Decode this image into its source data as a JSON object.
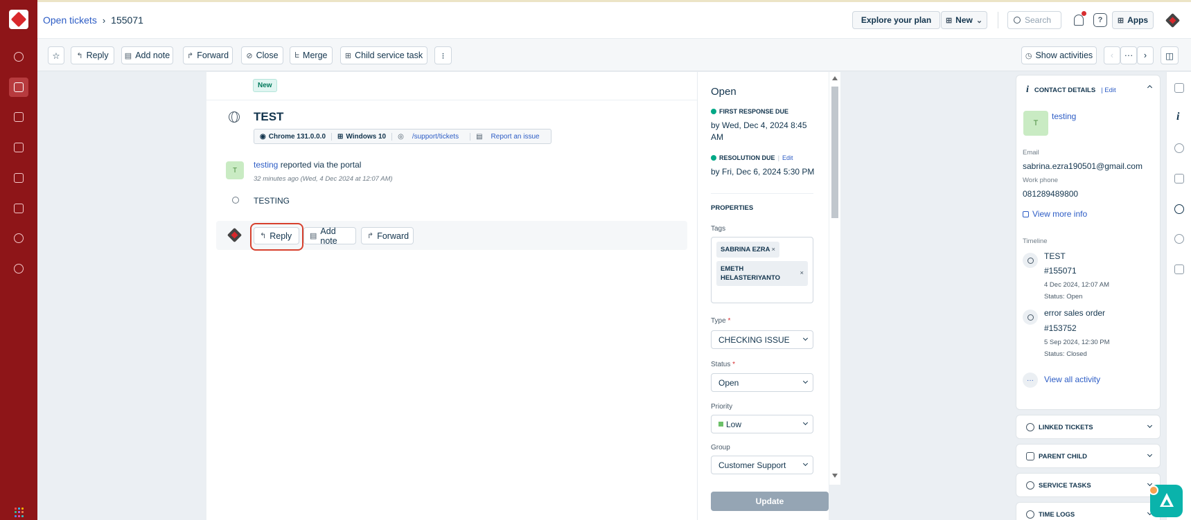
{
  "nav": {
    "items": [
      "dashboard-icon",
      "tickets-icon",
      "contacts-icon",
      "solutions-icon",
      "forums-icon",
      "reports-icon",
      "compass-icon",
      "admin-gear-icon"
    ],
    "apps_colors": [
      "#f24c4c",
      "#2fb6f0",
      "#f7b500",
      "#36c08f",
      "#9d6bf3",
      "#f27d4c",
      "#4c8cf2",
      "#e94cb8",
      "#33c2c2"
    ]
  },
  "breadcrumb": {
    "parent": "Open tickets",
    "separator": "›",
    "current": "155071"
  },
  "header": {
    "explore_plan": "Explore your plan",
    "new_label": "New",
    "search_placeholder": "Search",
    "help_label": "?",
    "apps_label": "Apps"
  },
  "toolbar": {
    "reply": "Reply",
    "add_note": "Add note",
    "forward": "Forward",
    "close": "Close",
    "merge": "Merge",
    "child_service_task": "Child service task",
    "more": "⁝",
    "show_activities": "Show activities",
    "prev": "‹",
    "dots": "···",
    "next": "›"
  },
  "ticket": {
    "badge": "New",
    "title": "TEST",
    "browser": "Chrome 131.0.0.0",
    "os": "Windows 10",
    "path": "/support/tickets",
    "report": "Report an issue",
    "requester_initial": "T",
    "requester_name": "testing",
    "reported_via": "reported via the portal",
    "time_ago": "32 minutes ago (Wed, 4 Dec 2024 at 12:07 AM)",
    "description": "TESTING"
  },
  "reply_bar": {
    "reply": "Reply",
    "add_note": "Add note",
    "forward": "Forward"
  },
  "properties": {
    "status_heading": "Open",
    "first_response_label": "FIRST RESPONSE DUE",
    "first_response_value": "by Wed, Dec 4, 2024 8:45 AM",
    "resolution_label": "RESOLUTION DUE",
    "resolution_edit": "Edit",
    "resolution_value": "by Fri, Dec 6, 2024 5:30 PM",
    "properties_heading": "PROPERTIES",
    "tags_label": "Tags",
    "tags": [
      "SABRINA EZRA",
      "EMETH HELASTERIYANTO"
    ],
    "tag_remove": "×",
    "type_label": "Type",
    "type_value": "CHECKING ISSUE",
    "status_label": "Status",
    "status_value": "Open",
    "priority_label": "Priority",
    "priority_value": "Low",
    "priority_color": "#6cc069",
    "group_label": "Group",
    "group_value": "Customer Support",
    "required_mark": "*",
    "update_button": "Update"
  },
  "contact": {
    "heading": "CONTACT DETAILS",
    "edit": "| Edit",
    "initial": "T",
    "name": "testing",
    "email_label": "Email",
    "email": "sabrina.ezra190501@gmail.com",
    "phone_label": "Work phone",
    "phone": "081289489800",
    "view_more": "View more info",
    "timeline_label": "Timeline",
    "timeline": [
      {
        "title": "TEST",
        "id": "#155071",
        "date": "4 Dec 2024, 12:07 AM",
        "status": "Status: Open"
      },
      {
        "title": "error sales order",
        "id": "#153752",
        "date": "5 Sep 2024, 12:30 PM",
        "status": "Status: Closed"
      }
    ],
    "view_all": "View all activity"
  },
  "accordions": {
    "linked": "LINKED TICKETS",
    "parent_child": "PARENT CHILD",
    "service_tasks": "SERVICE TASKS",
    "time_logs": "TIME LOGS"
  },
  "colors": {
    "nav_bg": "#8e1518",
    "link": "#2c5cc5",
    "highlight": "#d7402d",
    "fab": "#0ab3ab"
  }
}
